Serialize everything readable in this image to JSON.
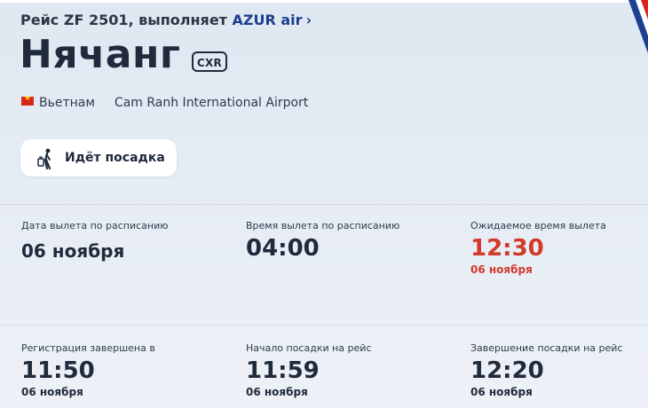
{
  "header": {
    "flight_prefix": "Рейс ZF 2501, выполняет",
    "airline": "AZUR air",
    "chevron": "›"
  },
  "destination": {
    "city": "Нячанг",
    "iata": "CXR",
    "country": "Вьетнам",
    "airport": "Cam Ranh International Airport",
    "flag_icon": "vietnam-flag-icon"
  },
  "status": {
    "icon": "boarding-person-icon",
    "label": "Идёт посадка"
  },
  "details": [
    {
      "label": "Дата вылета по расписанию",
      "value": "06 ноября"
    },
    {
      "label": "Время вылета по расписанию",
      "value": "04:00"
    },
    {
      "label": "Ожидаемое время вылета",
      "value": "12:30",
      "sub": "06 ноября"
    },
    {
      "label": "Регистрация завершена в",
      "value": "11:50",
      "sub": "06 ноября"
    },
    {
      "label": "Начало посадки на рейс",
      "value": "11:59",
      "sub": "06 ноября"
    },
    {
      "label": "Завершение посадки на рейс",
      "value": "12:20",
      "sub": "06 ноября"
    }
  ],
  "colors": {
    "accent_blue": "#1c3f8f",
    "delay_red": "#d33a2c",
    "text_dark": "#1f2a3c"
  }
}
